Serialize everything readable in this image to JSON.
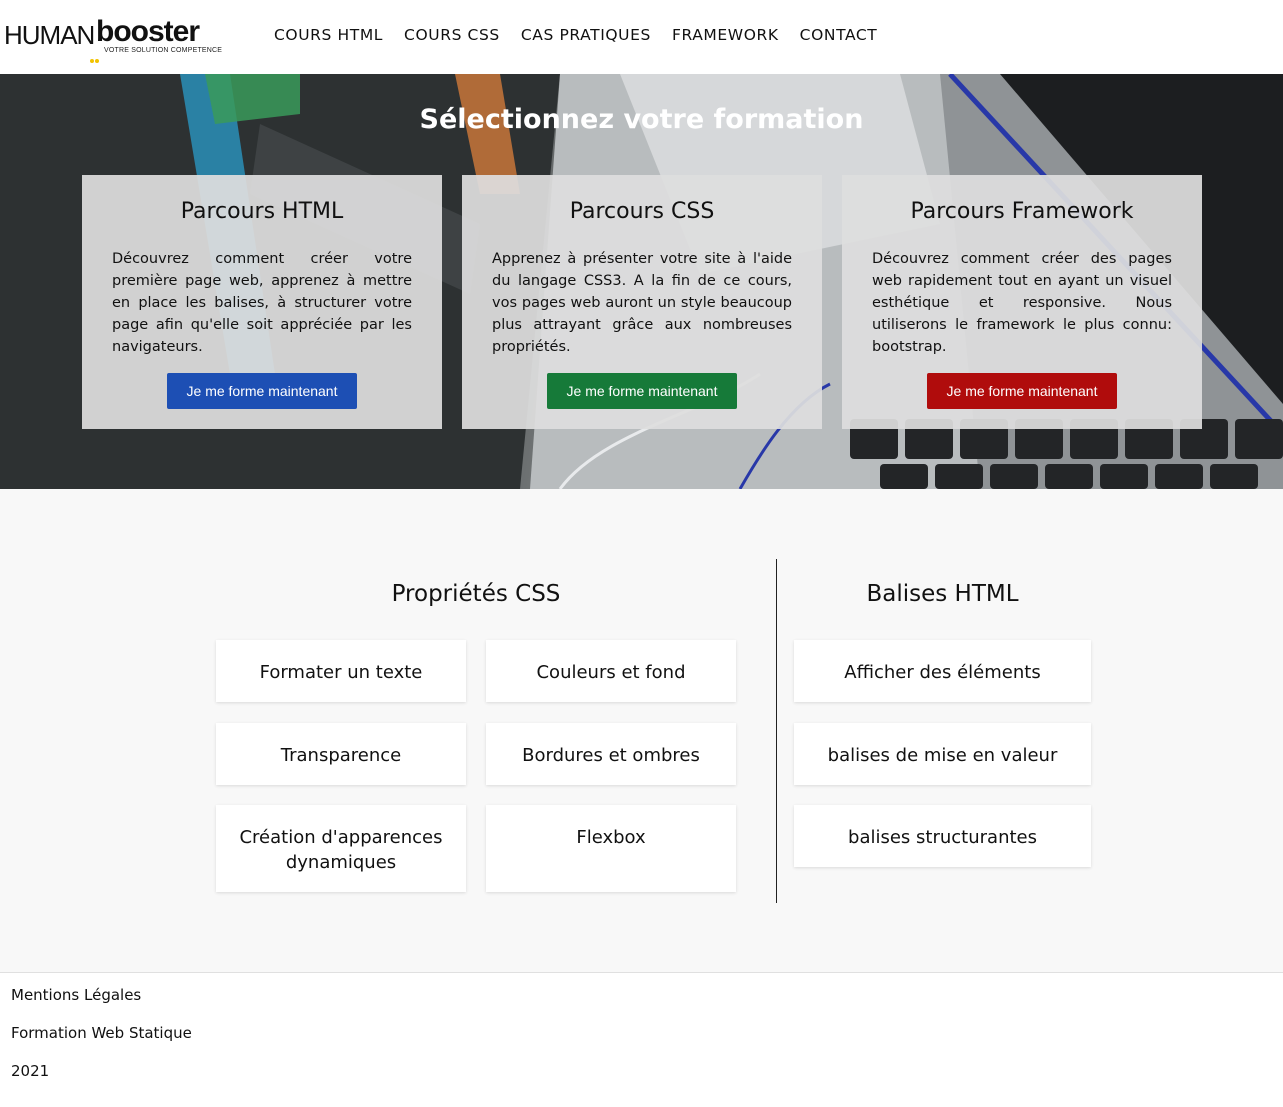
{
  "header": {
    "logo": {
      "human": "HUMAN",
      "booster": "booster",
      "tagline": "VOTRE SOLUTION COMPETENCE"
    },
    "nav": [
      "COURS HTML",
      "COURS CSS",
      "CAS PRATIQUES",
      "FRAMEWORK",
      "CONTACT"
    ]
  },
  "hero": {
    "title": "Sélectionnez votre formation",
    "cards": [
      {
        "title": "Parcours HTML",
        "text": "Découvrez comment créer votre première page web, apprenez à mettre en place les balises, à structurer votre page afin qu'elle soit appréciée par les navigateurs.",
        "button": "Je me forme maintenant",
        "color": "#1d4fb4"
      },
      {
        "title": "Parcours CSS",
        "text": "Apprenez à présenter votre site à l'aide du langage CSS3. A la fin de ce cours, vos pages web auront un style beaucoup plus attrayant grâce aux nombreuses propriétés.",
        "button": "Je me forme maintenant",
        "color": "#167a39"
      },
      {
        "title": "Parcours Framework",
        "text": "Découvrez comment créer des pages web rapidement tout en ayant un visuel esthétique et responsive. Nous utiliserons le framework le plus connu: bootstrap.",
        "button": "Je me forme maintenant",
        "color": "#b00c0c"
      }
    ]
  },
  "css_section": {
    "title": "Propriétés CSS",
    "items": [
      "Formater un texte",
      "Couleurs et fond",
      "Transparence",
      "Bordures et ombres",
      "Création d'apparences dynamiques",
      "Flexbox"
    ]
  },
  "html_section": {
    "title": "Balises HTML",
    "items": [
      "Afficher des éléments",
      "balises de mise en valeur",
      "balises structurantes"
    ]
  },
  "footer": {
    "legal": "Mentions Légales",
    "course": "Formation Web Statique",
    "year": "2021"
  }
}
